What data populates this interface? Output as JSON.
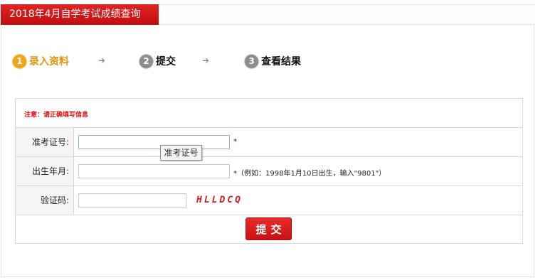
{
  "header": {
    "title": "2018年4月自学考试成绩查询"
  },
  "steps": [
    {
      "number": "1",
      "label": "录入资料"
    },
    {
      "number": "2",
      "label": "提交"
    },
    {
      "number": "3",
      "label": "查看结果"
    }
  ],
  "arrows": [
    "➜",
    "➜"
  ],
  "form": {
    "notice": "注意：请正确填写信息",
    "fields": [
      {
        "label": "准考证号:",
        "value": "",
        "suffix": "*"
      },
      {
        "label": "出生年月:",
        "value": "",
        "suffix": "*（例如：1998年1月10日出生，输入\"9801\"）"
      },
      {
        "label": "验证码:",
        "value": "",
        "captcha": "HLLDCQ"
      }
    ],
    "tooltip": "准考证号",
    "submit_label": "提交"
  },
  "colors": {
    "accent": "#d81616",
    "step_active": "#e3930e",
    "step_inactive": "#8d8d8d"
  }
}
